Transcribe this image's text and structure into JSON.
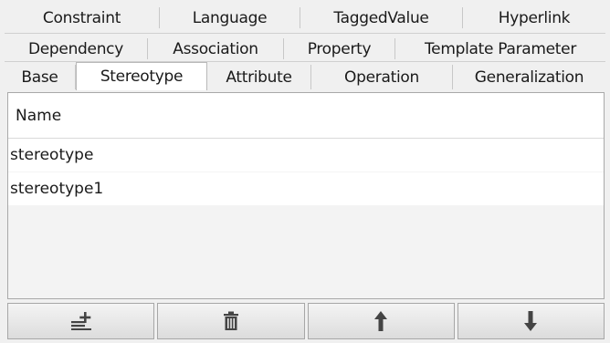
{
  "tabs": {
    "row1": [
      "Constraint",
      "Language",
      "TaggedValue",
      "Hyperlink"
    ],
    "row2": [
      "Dependency",
      "Association",
      "Property",
      "Template Parameter"
    ],
    "row3": [
      "Base",
      "Stereotype",
      "Attribute",
      "Operation",
      "Generalization"
    ],
    "active": "Stereotype"
  },
  "table": {
    "header": "Name",
    "rows": [
      "stereotype",
      "stereotype1"
    ]
  },
  "toolbar": {
    "buttons": [
      {
        "name": "add-button",
        "icon": "add-row-icon"
      },
      {
        "name": "delete-button",
        "icon": "trash-icon"
      },
      {
        "name": "move-up-button",
        "icon": "arrow-up-icon"
      },
      {
        "name": "move-down-button",
        "icon": "arrow-down-icon"
      }
    ]
  }
}
